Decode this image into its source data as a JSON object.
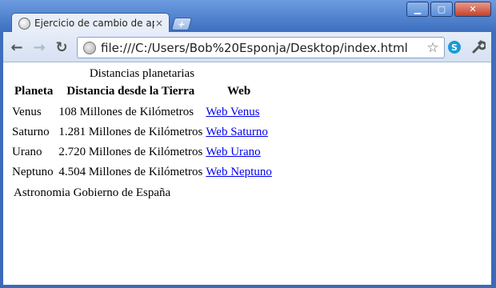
{
  "browser": {
    "tab_title": "Ejercicio de cambio de apar",
    "tab_close": "×",
    "new_tab": "+",
    "url": "file:///C:/Users/Bob%20Esponja/Desktop/index.html",
    "window_controls": {
      "minimize": "▁",
      "maximize": "▢",
      "close": "✕"
    },
    "icons": [
      "page-favicon",
      "back-arrow",
      "forward-arrow",
      "reload",
      "globe",
      "star",
      "skype-extension",
      "wrench-menu"
    ]
  },
  "page": {
    "caption": "Distancias planetarias",
    "headers": [
      "Planeta",
      "Distancia desde la Tierra",
      "Web"
    ],
    "rows": [
      {
        "planet": "Venus",
        "distance": "108 Millones de Kilómetros",
        "link": "Web Venus"
      },
      {
        "planet": "Saturno",
        "distance": "1.281 Millones de Kilómetros",
        "link": "Web Saturno"
      },
      {
        "planet": "Urano",
        "distance": "2.720 Millones de Kilómetros",
        "link": "Web Urano"
      },
      {
        "planet": "Neptuno",
        "distance": "4.504 Millones de Kilómetros",
        "link": "Web Neptuno"
      }
    ],
    "footer": "Astronomia Gobierno de España"
  }
}
